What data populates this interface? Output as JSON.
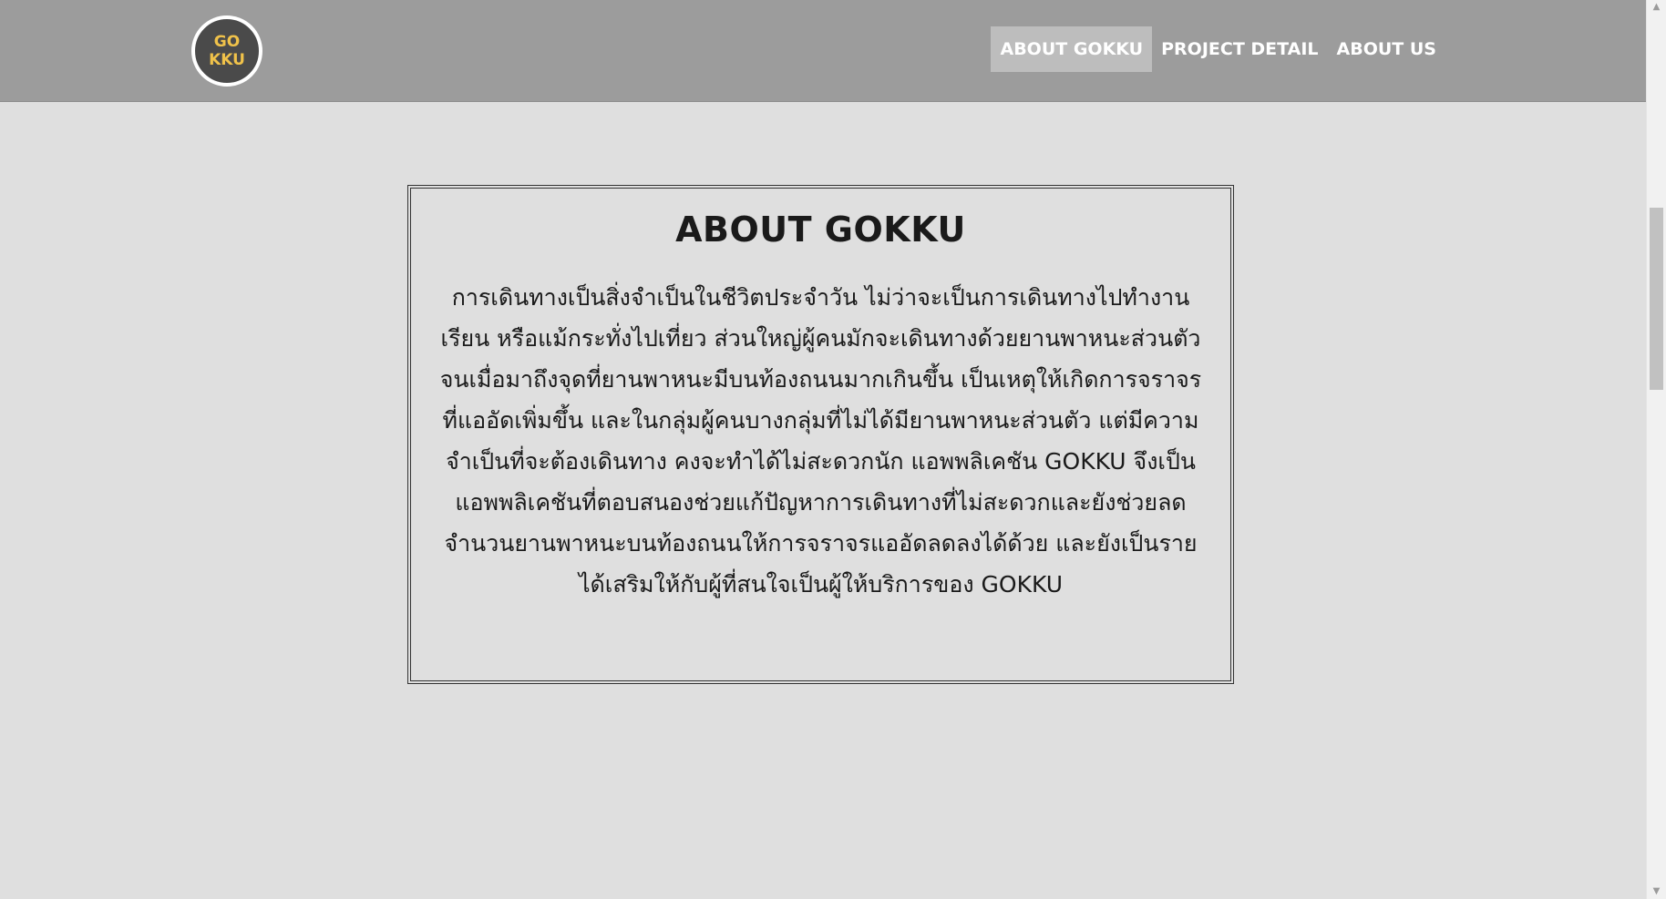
{
  "logo": {
    "line1": "GO",
    "line2": "KKU",
    "text_color": "#f0c24a",
    "bg_color": "#4a4a4a"
  },
  "nav": {
    "items": [
      {
        "label": "ABOUT GOKKU",
        "active": true
      },
      {
        "label": "PROJECT DETAIL",
        "active": false
      },
      {
        "label": "ABOUT US",
        "active": false
      }
    ]
  },
  "main": {
    "title": "ABOUT GOKKU",
    "body": "การเดินทางเป็นสิ่งจำเป็นในชีวิตประจำวัน ไม่ว่าจะเป็นการเดินทางไปทำงาน เรียน หรือแม้กระทั่งไปเที่ยว ส่วนใหญ่ผู้คนมักจะเดินทางด้วยยานพาหนะส่วนตัว จนเมื่อมาถึงจุดที่ยานพาหนะมีบนท้องถนนมากเกินขึ้น เป็นเหตุให้เกิดการจราจรที่แออัดเพิ่มขึ้น และในกลุ่มผู้คนบางกลุ่มที่ไม่ได้มียานพาหนะส่วนตัว แต่มีความจำเป็นที่จะต้องเดินทาง คงจะทำได้ไม่สะดวกนัก แอพพลิเคชัน GOKKU จึงเป็นแอพพลิเคชันที่ตอบสนองช่วยแก้ปัญหาการเดินทางที่ไม่สะดวกและยังช่วยลดจำนวนยานพาหนะบนท้องถนนให้การจราจรแออัดลดลงได้ด้วย และยังเป็นรายได้เสริมให้กับผู้ที่สนใจเป็นผู้ให้บริการของ GOKKU"
  },
  "colors": {
    "navbar_bg": "#9c9c9c",
    "page_bg": "#dfdfdf",
    "active_nav_bg": "#bdbdbd"
  }
}
